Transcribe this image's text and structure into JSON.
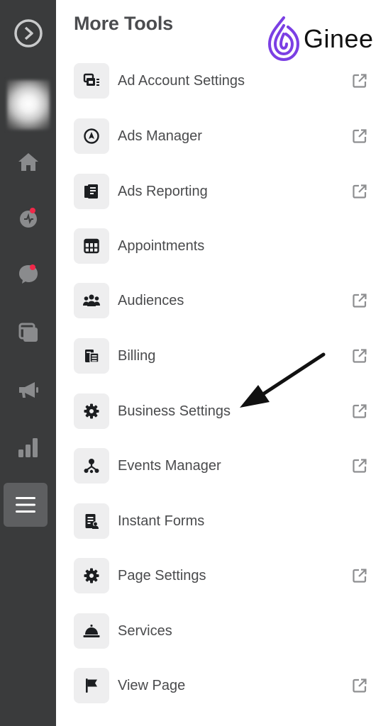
{
  "panel": {
    "title": "More Tools"
  },
  "brand": {
    "name": "Ginee",
    "color": "#7b3fe4"
  },
  "rail": {
    "items": [
      {
        "icon": "logo-circle-arrow-icon"
      },
      {
        "icon": "profile-avatar"
      },
      {
        "icon": "home-icon"
      },
      {
        "icon": "activity-icon",
        "badge": true
      },
      {
        "icon": "messages-icon",
        "badge": true
      },
      {
        "icon": "posts-icon"
      },
      {
        "icon": "megaphone-icon"
      },
      {
        "icon": "insights-bar-chart-icon"
      },
      {
        "icon": "menu-icon",
        "active": true
      }
    ]
  },
  "tools": [
    {
      "label": "Ad Account Settings",
      "icon": "ad-account-icon",
      "external": true
    },
    {
      "label": "Ads Manager",
      "icon": "compass-icon",
      "external": true
    },
    {
      "label": "Ads Reporting",
      "icon": "report-icon",
      "external": true
    },
    {
      "label": "Appointments",
      "icon": "calendar-grid-icon",
      "external": false
    },
    {
      "label": "Audiences",
      "icon": "people-icon",
      "external": true
    },
    {
      "label": "Billing",
      "icon": "billing-stack-icon",
      "external": true
    },
    {
      "label": "Business Settings",
      "icon": "gear-icon",
      "external": true
    },
    {
      "label": "Events Manager",
      "icon": "events-nodes-icon",
      "external": true
    },
    {
      "label": "Instant Forms",
      "icon": "form-icon",
      "external": false
    },
    {
      "label": "Page Settings",
      "icon": "gear-icon",
      "external": true
    },
    {
      "label": "Services",
      "icon": "service-bell-icon",
      "external": false
    },
    {
      "label": "View Page",
      "icon": "flag-icon",
      "external": true
    }
  ],
  "annotation": {
    "type": "arrow",
    "points_to": "Business Settings"
  },
  "colors": {
    "rail_bg": "#3a3b3c",
    "icon_tile_bg": "#eeeeef",
    "badge": "#f02849",
    "text": "#4a4b4d"
  }
}
